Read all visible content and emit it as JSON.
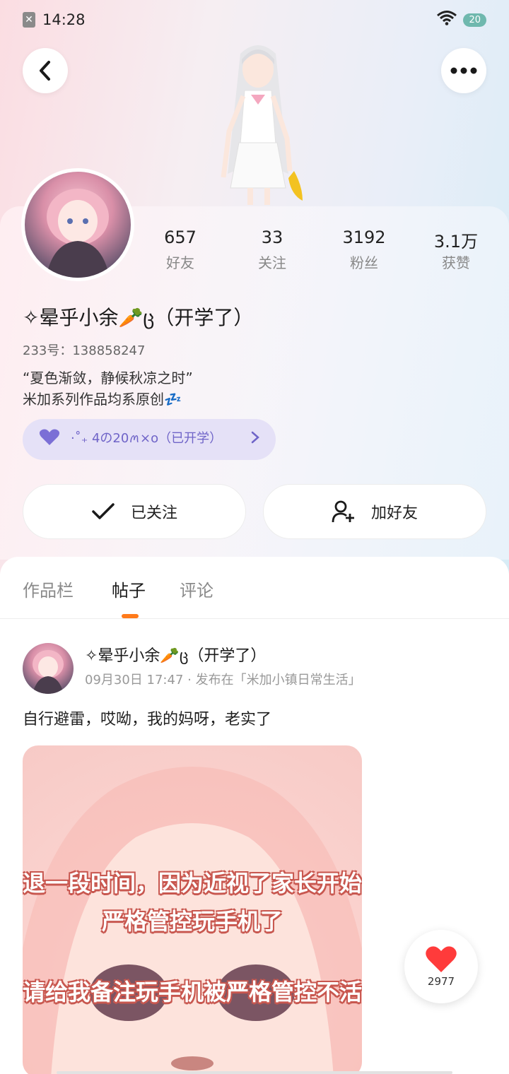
{
  "status_bar": {
    "time": "14:28",
    "battery": "20"
  },
  "profile": {
    "stats": [
      {
        "value": "657",
        "label": "好友"
      },
      {
        "value": "33",
        "label": "关注"
      },
      {
        "value": "3192",
        "label": "粉丝"
      },
      {
        "value": "3.1万",
        "label": "获赞"
      }
    ],
    "username": "✧晕乎小余🥕ც（开学了）",
    "uid": "233号：138858247",
    "bio_line1": "“夏色渐敛，静候秋凉之时”",
    "bio_line2": "米加系列作品均系原创💤",
    "badge_text": "·˚₊ 4の20ꪔ×о（已开学）"
  },
  "actions": {
    "follow_label": "已关注",
    "add_friend_label": "加好友"
  },
  "tabs": [
    {
      "label": "作品栏"
    },
    {
      "label": "帖子"
    },
    {
      "label": "评论"
    }
  ],
  "post": {
    "author": "✧晕乎小余🥕ც（开学了）",
    "meta": "09月30日 17:47 · 发布在「米加小镇日常生活」",
    "text": "自行避雷，哎呦，我的妈呀，老实了",
    "image_text_1": "退一段时间，因为近视了家长开始严格管控玩手机了",
    "image_text_2": "请给我备注玩手机被严格管控不活"
  },
  "like_count": "2977",
  "colors": {
    "accent": "#ff7a1a",
    "badge_bg": "#e5e1f7",
    "heart": "#ff3b3b"
  }
}
